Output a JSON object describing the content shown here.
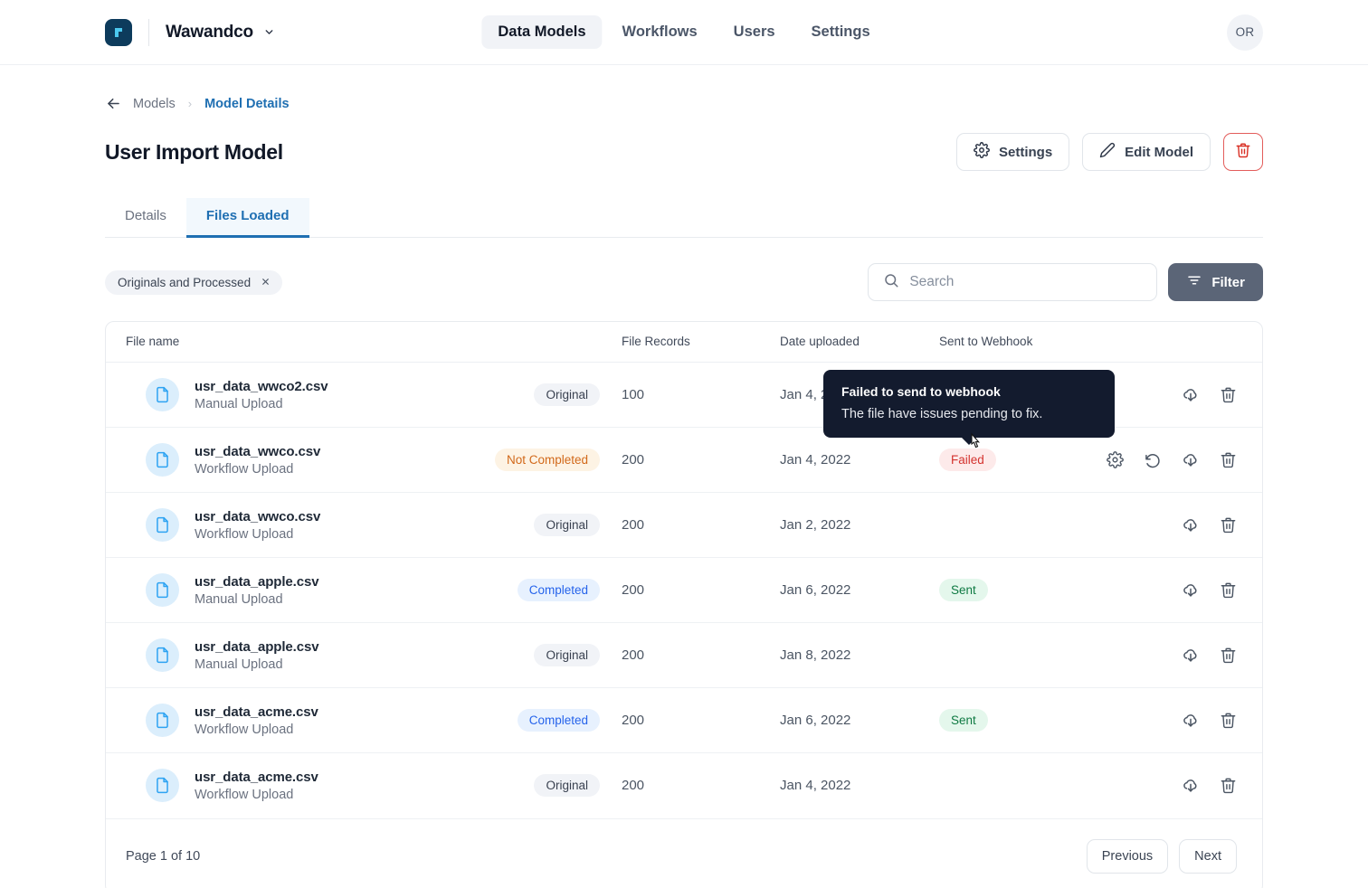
{
  "topnav": {
    "brand": "Wawandco",
    "logo_icon": "wawandco-logo-icon",
    "caret_icon": "chevron-down-icon",
    "links": [
      {
        "label": "Data Models",
        "active": true
      },
      {
        "label": "Workflows",
        "active": false
      },
      {
        "label": "Users",
        "active": false
      },
      {
        "label": "Settings",
        "active": false
      }
    ],
    "avatar_initials": "OR"
  },
  "breadcrumb": {
    "back_icon": "arrow-left-icon",
    "parent": "Models",
    "separator": "›",
    "current": "Model Details"
  },
  "header": {
    "title": "User Import Model",
    "settings_label": "Settings",
    "settings_icon": "gear-icon",
    "edit_label": "Edit Model",
    "edit_icon": "pencil-icon",
    "delete_icon": "trash-icon",
    "delete_color": "#e35d5b"
  },
  "tabs": [
    {
      "label": "Details",
      "active": false
    },
    {
      "label": "Files Loaded",
      "active": true
    }
  ],
  "filterbar": {
    "chip_label": "Originals and Processed",
    "chip_close_icon": "close-icon",
    "search_placeholder": "Search",
    "search_value": "",
    "search_icon": "search-icon",
    "filter_label": "Filter",
    "filter_icon": "filter-lines-icon",
    "filter_button_color": "#5b6577"
  },
  "table": {
    "columns": [
      "File name",
      "File Records",
      "Date uploaded",
      "Sent to Webhook"
    ],
    "rows": [
      {
        "file_name": "usr_data_wwco2.csv",
        "upload_type": "Manual Upload",
        "status": "Original",
        "status_kind": "original",
        "records": "100",
        "date": "Jan 4, 2022",
        "webhook": "",
        "webhook_kind": "",
        "actions": [
          "download-icon",
          "trash-icon"
        ]
      },
      {
        "file_name": "usr_data_wwco.csv",
        "upload_type": "Workflow Upload",
        "status": "Not Completed",
        "status_kind": "notcomp",
        "records": "200",
        "date": "Jan 4, 2022",
        "webhook": "Failed",
        "webhook_kind": "failed",
        "actions": [
          "gear-icon",
          "retry-icon",
          "download-icon",
          "trash-icon"
        ]
      },
      {
        "file_name": "usr_data_wwco.csv",
        "upload_type": "Workflow Upload",
        "status": "Original",
        "status_kind": "original",
        "records": "200",
        "date": "Jan 2, 2022",
        "webhook": "",
        "webhook_kind": "",
        "actions": [
          "download-icon",
          "trash-icon"
        ]
      },
      {
        "file_name": "usr_data_apple.csv",
        "upload_type": "Manual Upload",
        "status": "Completed",
        "status_kind": "completed",
        "records": "200",
        "date": "Jan 6, 2022",
        "webhook": "Sent",
        "webhook_kind": "sent",
        "actions": [
          "download-icon",
          "trash-icon"
        ]
      },
      {
        "file_name": "usr_data_apple.csv",
        "upload_type": "Manual Upload",
        "status": "Original",
        "status_kind": "original",
        "records": "200",
        "date": "Jan 8, 2022",
        "webhook": "",
        "webhook_kind": "",
        "actions": [
          "download-icon",
          "trash-icon"
        ]
      },
      {
        "file_name": "usr_data_acme.csv",
        "upload_type": "Workflow Upload",
        "status": "Completed",
        "status_kind": "completed",
        "records": "200",
        "date": "Jan 6, 2022",
        "webhook": "Sent",
        "webhook_kind": "sent",
        "actions": [
          "download-icon",
          "trash-icon"
        ]
      },
      {
        "file_name": "usr_data_acme.csv",
        "upload_type": "Workflow Upload",
        "status": "Original",
        "status_kind": "original",
        "records": "200",
        "date": "Jan 4, 2022",
        "webhook": "",
        "webhook_kind": "",
        "actions": [
          "download-icon",
          "trash-icon"
        ]
      }
    ]
  },
  "tooltip": {
    "title": "Failed to send to webhook",
    "body": "The file have issues pending to fix."
  },
  "pagination": {
    "info": "Page 1 of 10",
    "previous": "Previous",
    "next": "Next"
  }
}
